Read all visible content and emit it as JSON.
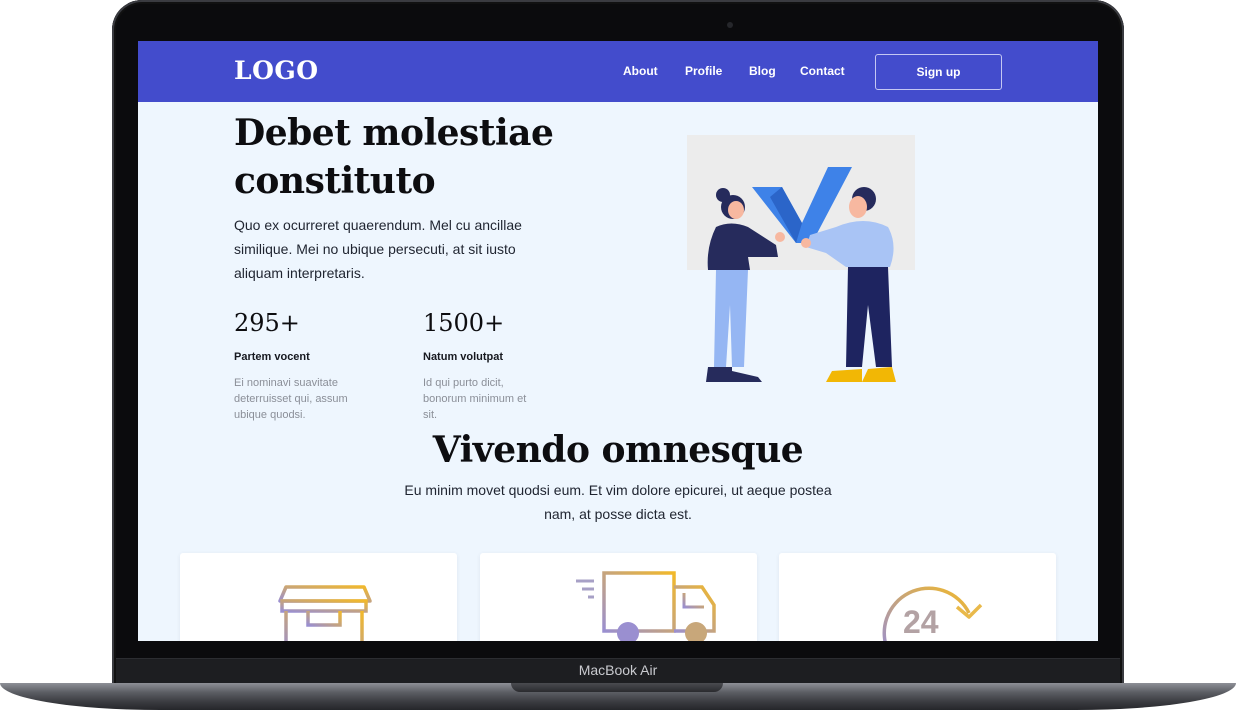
{
  "device": {
    "label": "MacBook Air"
  },
  "nav": {
    "logo": "LOGO",
    "links": [
      "About",
      "Profile",
      "Blog",
      "Contact"
    ],
    "signup": "Sign up"
  },
  "hero": {
    "title": "Debet molestiae constituto",
    "text": "Quo ex ocurreret quaerendum. Mel cu ancillae similique. Mei no ubique persecuti, at sit iusto aliquam interpretaris.",
    "stats": [
      {
        "value": "295+",
        "label": "Partem vocent",
        "desc": "Ei nominavi suavitate deterruisset qui, assum ubique quodsi."
      },
      {
        "value": "1500+",
        "label": "Natum volutpat",
        "desc": "Id qui purto dicit, bonorum minimum et sit."
      }
    ]
  },
  "section": {
    "title": "Vivendo omnesque",
    "text": "Eu minim movet quodsi eum. Et vim dolore epicurei, ut aeque postea nam, at posse dicta est."
  },
  "cards": [
    {
      "icon": "box-icon"
    },
    {
      "icon": "delivery-truck-icon"
    },
    {
      "icon": "24-hours-icon",
      "label": "24"
    }
  ],
  "colors": {
    "nav": "#434ccc",
    "background": "#eef6fe",
    "gradient_start": "#9a8fd0",
    "gradient_end": "#f2b92a"
  }
}
